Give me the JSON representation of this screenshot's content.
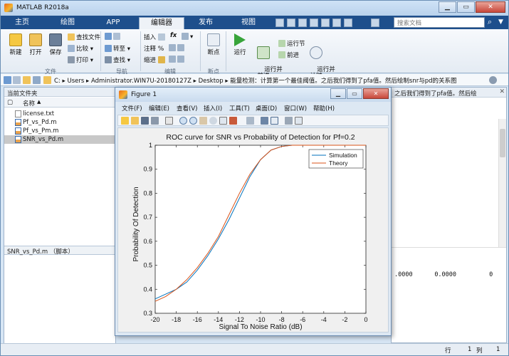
{
  "app": {
    "title": "MATLAB R2018a",
    "window_buttons": {
      "minimize": "▁",
      "maximize": "▭",
      "close": "✕"
    }
  },
  "tabs": [
    "主页",
    "绘图",
    "APP",
    "编辑器",
    "发布",
    "视图"
  ],
  "search": {
    "placeholder": "搜索文档"
  },
  "ribbon": {
    "file": {
      "new": "新建",
      "open": "打开",
      "save": "保存",
      "find_files": "查找文件",
      "compare": "比较",
      "print": "打印",
      "group": "文件"
    },
    "nav": {
      "goto": "转至",
      "find": "查找",
      "group": "导航"
    },
    "edit": {
      "insert": "插入",
      "comment": "注释",
      "indent": "缩进",
      "fx": "fx",
      "group": "编辑"
    },
    "breakpoints": {
      "label": "断点",
      "group": "断点"
    },
    "run": {
      "run": "运行",
      "run_advance": "运行并\n前进",
      "run_section": "运行节",
      "advance": "前进",
      "run_time": "运行并\n计时"
    }
  },
  "address": {
    "drive": "C:",
    "segments": [
      "Users",
      "Administrator.WIN7U-20180127Z",
      "Desktop",
      "能量检测：计算第一个最佳阈值。之后我们得到了pfa值。然后绘制snr与pd的关系图"
    ]
  },
  "left_pane": {
    "title": "当前文件夹",
    "column_name": "名称",
    "files": [
      "license.txt",
      "Pf_vs_Pd.m",
      "Pf_vs_Pm.m",
      "SNR_vs_Pd.m"
    ],
    "selected": "SNR_vs_Pd.m",
    "detail": "SNR_vs_Pd.m （脚本）"
  },
  "right_pane": {
    "header": "之后我们得到了pfa值。然后绘",
    "cmd_values": [
      ".0000",
      "0.0000",
      "0"
    ]
  },
  "statusbar": {
    "row_label": "行",
    "row": "1",
    "col_label": "列",
    "col": "1"
  },
  "figure": {
    "title": "Figure 1",
    "menus": [
      "文件(F)",
      "编辑(E)",
      "查看(V)",
      "插入(I)",
      "工具(T)",
      "桌面(D)",
      "窗口(W)",
      "帮助(H)"
    ]
  },
  "chart_data": {
    "type": "line",
    "title": "ROC curve for SNR vs Probability of Detection for Pf=0.2",
    "xlabel": "Signal To Noise Ratio (dB)",
    "ylabel": "Probability Of Detection",
    "xlim": [
      -20,
      0
    ],
    "ylim": [
      0.3,
      1
    ],
    "xticks": [
      -20,
      -18,
      -16,
      -14,
      -12,
      -10,
      -8,
      -6,
      -4,
      -2,
      0
    ],
    "yticks": [
      0.3,
      0.4,
      0.5,
      0.6,
      0.7,
      0.8,
      0.9,
      1
    ],
    "grid": false,
    "legend": "top-right",
    "series": [
      {
        "name": "Simulation",
        "color": "#0072BD",
        "x": [
          -20,
          -19,
          -18,
          -17,
          -16,
          -15,
          -14,
          -13,
          -12,
          -11,
          -10,
          -9,
          -8,
          -7,
          -6,
          -4,
          -2,
          0
        ],
        "y": [
          0.36,
          0.38,
          0.4,
          0.43,
          0.48,
          0.54,
          0.61,
          0.69,
          0.78,
          0.87,
          0.94,
          0.98,
          0.995,
          1.0,
          1.0,
          1.0,
          1.0,
          1.0
        ]
      },
      {
        "name": "Theory",
        "color": "#D95319",
        "x": [
          -20,
          -19,
          -18,
          -17,
          -16,
          -15,
          -14,
          -13,
          -12,
          -11,
          -10,
          -9,
          -8,
          -7,
          -6,
          -4,
          -2,
          0
        ],
        "y": [
          0.35,
          0.37,
          0.4,
          0.44,
          0.49,
          0.55,
          0.62,
          0.71,
          0.8,
          0.88,
          0.94,
          0.98,
          0.995,
          1.0,
          1.0,
          1.0,
          1.0,
          1.0
        ]
      }
    ]
  }
}
